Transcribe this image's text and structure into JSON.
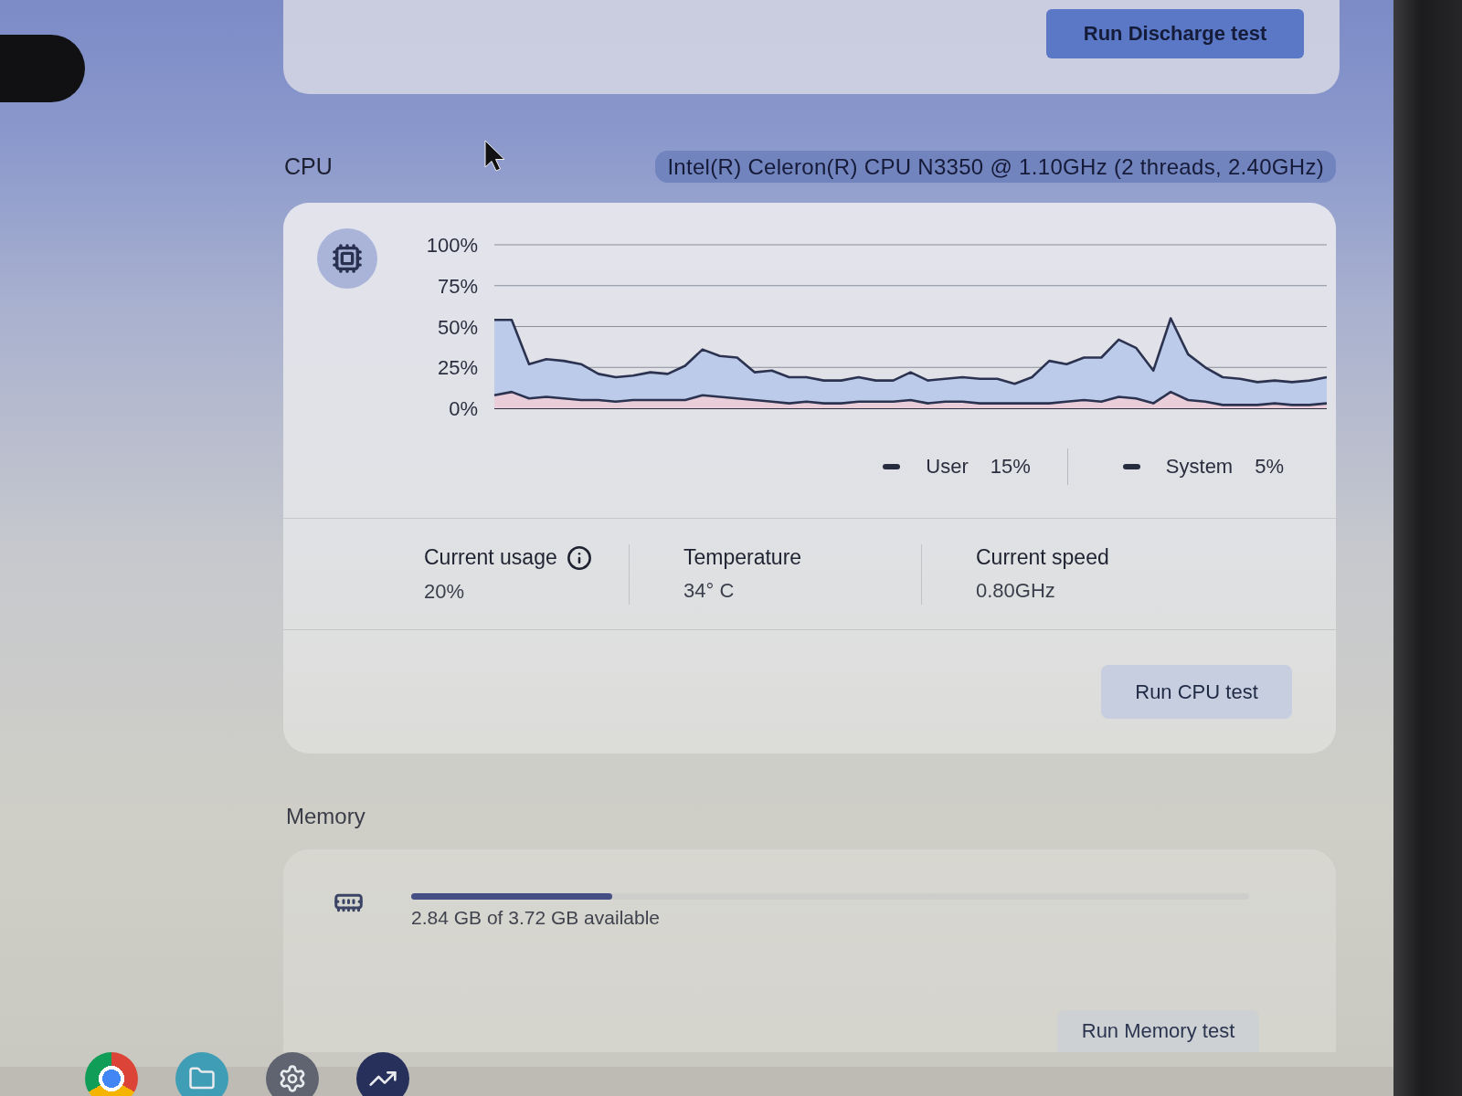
{
  "top_card": {
    "button": "Run Discharge test"
  },
  "cpu": {
    "title": "CPU",
    "model": "Intel(R) Celeron(R) CPU N3350 @ 1.10GHz (2 threads, 2.40GHz)",
    "chart_data": [
      {
        "type": "area",
        "stacked": true,
        "grid": true,
        "tick_labels": "y",
        "ylim": [
          0,
          100
        ],
        "yticks": [
          {
            "value": 100,
            "label": "100%"
          },
          {
            "value": 75,
            "label": "75%"
          },
          {
            "value": 50,
            "label": "50%"
          },
          {
            "value": 25,
            "label": "25%"
          },
          {
            "value": 0,
            "label": "0%"
          }
        ],
        "series": [
          {
            "color": "#e9cdd8",
            "values": [
              8,
              10,
              6,
              7,
              6,
              5,
              5,
              4,
              5,
              5,
              5,
              5,
              8,
              7,
              6,
              5,
              4,
              3,
              4,
              3,
              3,
              4,
              4,
              4,
              5,
              3,
              4,
              4,
              3,
              3,
              3,
              3,
              3,
              4,
              5,
              4,
              7,
              6,
              3,
              10,
              5,
              4,
              2,
              2,
              2,
              3,
              2,
              2,
              3
            ]
          },
          {
            "color": "#bccbea",
            "values": [
              46,
              44,
              21,
              23,
              23,
              22,
              16,
              15,
              15,
              17,
              16,
              21,
              28,
              25,
              25,
              17,
              19,
              16,
              15,
              14,
              14,
              15,
              13,
              13,
              17,
              14,
              14,
              15,
              15,
              15,
              12,
              16,
              26,
              23,
              26,
              27,
              35,
              31,
              20,
              45,
              28,
              21,
              17,
              16,
              14,
              14,
              14,
              15,
              16
            ]
          }
        ]
      }
    ],
    "legend": [
      {
        "label": "User",
        "value": "15%"
      },
      {
        "label": "System",
        "value": "5%"
      }
    ],
    "stats": [
      {
        "label": "Current usage",
        "value": "20%",
        "info": true
      },
      {
        "label": "Temperature",
        "value": "34° C",
        "info": false
      },
      {
        "label": "Current speed",
        "value": "0.80GHz",
        "info": false
      }
    ],
    "button": "Run CPU test"
  },
  "memory": {
    "title": "Memory",
    "level": 0.24,
    "available": "2.84 GB of 3.72 GB available",
    "button": "Run Memory test"
  }
}
